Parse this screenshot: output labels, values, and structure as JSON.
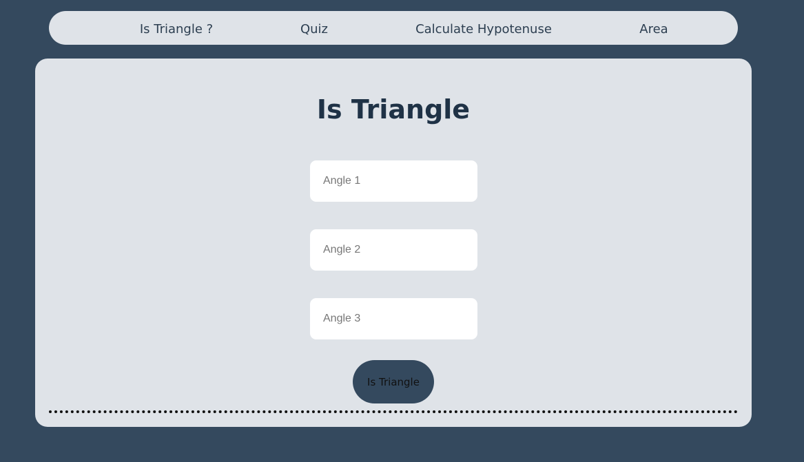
{
  "nav": {
    "items": [
      {
        "label": "Is Triangle ?"
      },
      {
        "label": "Quiz"
      },
      {
        "label": "Calculate Hypotenuse"
      },
      {
        "label": "Area"
      }
    ]
  },
  "main": {
    "title": "Is Triangle",
    "inputs": [
      {
        "placeholder": "Angle 1",
        "value": ""
      },
      {
        "placeholder": "Angle 2",
        "value": ""
      },
      {
        "placeholder": "Angle 3",
        "value": ""
      }
    ],
    "button_label": "Is Triangle"
  },
  "colors": {
    "background": "#34495e",
    "panel": "#dfe3e8",
    "button": "#34495e",
    "title": "#1f3246"
  }
}
